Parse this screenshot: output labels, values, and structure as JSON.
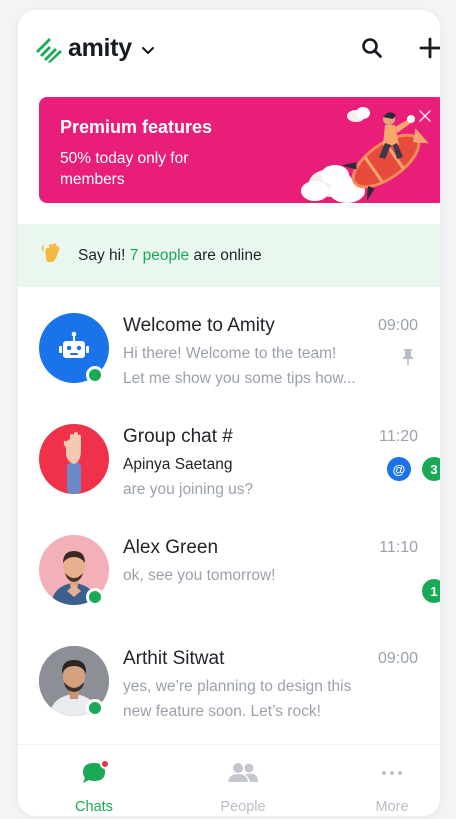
{
  "header": {
    "brand_name": "amity",
    "brand_color": "#1aaa55"
  },
  "banner": {
    "title": "Premium features",
    "text": "50% today only for members",
    "color": "#e91e78"
  },
  "online": {
    "prefix": "Say hi!",
    "count": "7 people",
    "suffix": "are online"
  },
  "chats": [
    {
      "name": "Welcome to Amity",
      "time": "09:00",
      "line1": "Hi there! Welcome to the team!",
      "line2": "Let me show you some tips how...",
      "pinned": true,
      "online": true,
      "avatar": "bot-icon"
    },
    {
      "name": "Group chat #",
      "time": "11:20",
      "sender": "Apinya Saetang",
      "message": "are you joining us?",
      "mention_badge": "@",
      "unread": "3",
      "online": false,
      "avatar": "raised-hand-photo"
    },
    {
      "name": "Alex Green",
      "time": "11:10",
      "message": "ok, see you tomorrow!",
      "unread": "1",
      "online": true,
      "avatar": "person-photo"
    },
    {
      "name": "Arthit Sitwat",
      "time": "09:00",
      "line1": "yes, we’re planning to design this",
      "line2": "new feature soon. Let’s rock!",
      "online": true,
      "avatar": "person-photo"
    }
  ],
  "tabs": [
    {
      "label": "Chats",
      "icon": "chat-bubble-icon",
      "active": true,
      "has_notification": true
    },
    {
      "label": "People",
      "icon": "people-icon",
      "active": false
    },
    {
      "label": "More",
      "icon": "more-dots-icon",
      "active": false
    }
  ],
  "colors": {
    "accent": "#1aaa55",
    "mention": "#1a73e8",
    "muted_text": "#9aa1aa",
    "online_strip": "#eaf7ef"
  }
}
